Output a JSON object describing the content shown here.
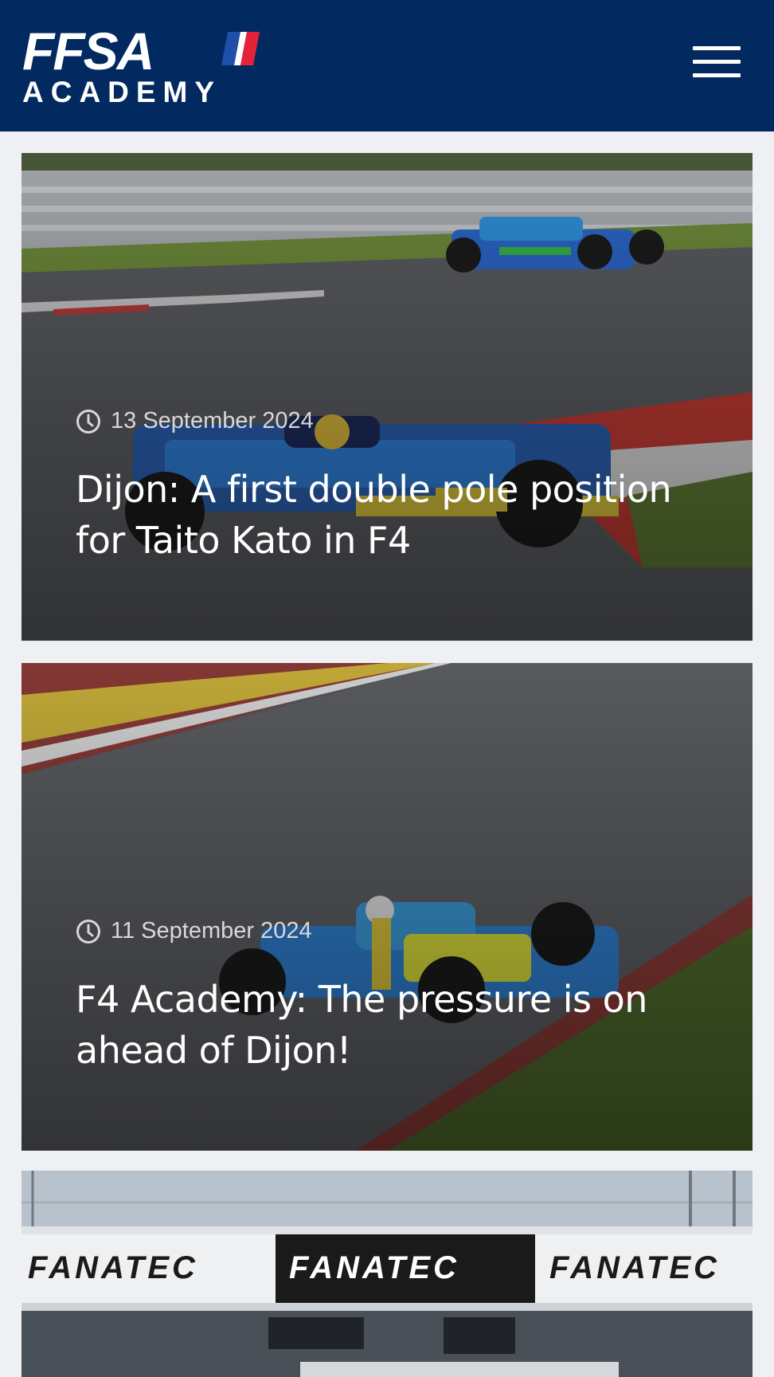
{
  "header": {
    "logo_main": "FFSA",
    "logo_sub": "ACADEMY",
    "colors": {
      "background": "#022960",
      "flag_blue": "#1f4fa8",
      "flag_red": "#e4223a"
    }
  },
  "menu_icon": "hamburger-menu-icon",
  "articles": [
    {
      "date": "13 September 2024",
      "title": "Dijon: A first double pole position for Taito Kato in F4",
      "date_icon": "clock-icon"
    },
    {
      "date": "11 September 2024",
      "title": "F4 Academy: The pressure is on ahead of Dijon!",
      "date_icon": "clock-icon"
    }
  ],
  "banner": {
    "text": "FANATEC",
    "text_2": "FANATEC",
    "text_3": "FANATEC"
  }
}
